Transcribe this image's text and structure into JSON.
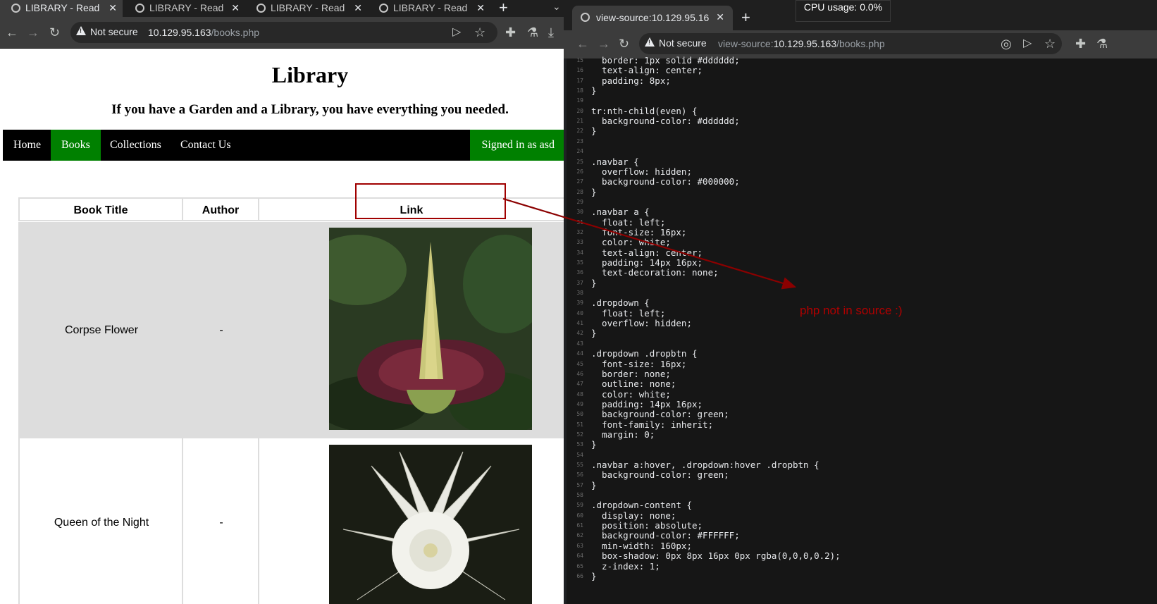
{
  "left_browser": {
    "tabs": [
      {
        "title": "LIBRARY - Read |"
      },
      {
        "title": "LIBRARY - Read |"
      },
      {
        "title": "LIBRARY - Read |"
      },
      {
        "title": "LIBRARY - Read |"
      }
    ],
    "security_label": "Not secure",
    "url_host": "10.129.95.163",
    "url_path": "/books.php"
  },
  "site": {
    "title": "Library",
    "subtitle": "If you have a Garden and a Library, you have everything you needed.",
    "nav": [
      {
        "label": "Home"
      },
      {
        "label": "Books"
      },
      {
        "label": "Collections"
      },
      {
        "label": "Contact Us"
      }
    ],
    "signed_in": "Signed in as asd",
    "table": {
      "headers": [
        "Book Title",
        "Author",
        "Link"
      ],
      "rows": [
        {
          "title": "Corpse Flower",
          "author": "-"
        },
        {
          "title": "Queen of the Night",
          "author": "-"
        }
      ]
    }
  },
  "right_browser": {
    "tab_title": "view-source:10.129.95.16",
    "cpu": "CPU usage: 0.0%",
    "url_prefix": "view-source:",
    "url_host": "10.129.95.163",
    "url_path": "/books.php",
    "source_lines": [
      {
        "n": "15",
        "t": "  border: 1px solid #dddddd;"
      },
      {
        "n": "16",
        "t": "  text-align: center;"
      },
      {
        "n": "17",
        "t": "  padding: 8px;"
      },
      {
        "n": "18",
        "t": "}"
      },
      {
        "n": "19",
        "t": ""
      },
      {
        "n": "20",
        "t": "tr:nth-child(even) {"
      },
      {
        "n": "21",
        "t": "  background-color: #dddddd;"
      },
      {
        "n": "22",
        "t": "}"
      },
      {
        "n": "23",
        "t": ""
      },
      {
        "n": "24",
        "t": ""
      },
      {
        "n": "25",
        "t": ".navbar {"
      },
      {
        "n": "26",
        "t": "  overflow: hidden;"
      },
      {
        "n": "27",
        "t": "  background-color: #000000;"
      },
      {
        "n": "28",
        "t": "}"
      },
      {
        "n": "29",
        "t": ""
      },
      {
        "n": "30",
        "t": ".navbar a {"
      },
      {
        "n": "31",
        "t": "  float: left;"
      },
      {
        "n": "32",
        "t": "  font-size: 16px;"
      },
      {
        "n": "33",
        "t": "  color: white;"
      },
      {
        "n": "34",
        "t": "  text-align: center;"
      },
      {
        "n": "35",
        "t": "  padding: 14px 16px;"
      },
      {
        "n": "36",
        "t": "  text-decoration: none;"
      },
      {
        "n": "37",
        "t": "}"
      },
      {
        "n": "38",
        "t": ""
      },
      {
        "n": "39",
        "t": ".dropdown {"
      },
      {
        "n": "40",
        "t": "  float: left;"
      },
      {
        "n": "41",
        "t": "  overflow: hidden;"
      },
      {
        "n": "42",
        "t": "}"
      },
      {
        "n": "43",
        "t": ""
      },
      {
        "n": "44",
        "t": ".dropdown .dropbtn {"
      },
      {
        "n": "45",
        "t": "  font-size: 16px;"
      },
      {
        "n": "46",
        "t": "  border: none;"
      },
      {
        "n": "47",
        "t": "  outline: none;"
      },
      {
        "n": "48",
        "t": "  color: white;"
      },
      {
        "n": "49",
        "t": "  padding: 14px 16px;"
      },
      {
        "n": "50",
        "t": "  background-color: green;"
      },
      {
        "n": "51",
        "t": "  font-family: inherit;"
      },
      {
        "n": "52",
        "t": "  margin: 0;"
      },
      {
        "n": "53",
        "t": "}"
      },
      {
        "n": "54",
        "t": ""
      },
      {
        "n": "55",
        "t": ".navbar a:hover, .dropdown:hover .dropbtn {"
      },
      {
        "n": "56",
        "t": "  background-color: green;"
      },
      {
        "n": "57",
        "t": "}"
      },
      {
        "n": "58",
        "t": ""
      },
      {
        "n": "59",
        "t": ".dropdown-content {"
      },
      {
        "n": "60",
        "t": "  display: none;"
      },
      {
        "n": "61",
        "t": "  position: absolute;"
      },
      {
        "n": "62",
        "t": "  background-color: #FFFFFF;"
      },
      {
        "n": "63",
        "t": "  min-width: 160px;"
      },
      {
        "n": "64",
        "t": "  box-shadow: 0px 8px 16px 0px rgba(0,0,0,0.2);"
      },
      {
        "n": "65",
        "t": "  z-index: 1;"
      },
      {
        "n": "66",
        "t": "}"
      }
    ]
  },
  "annotation": {
    "text": "php not in source :)",
    "color": "#b00000"
  },
  "colors": {
    "nav_active": "#008000",
    "navbar_bg": "#000000",
    "row_even": "#dddddd",
    "highlight_box": "#a00000"
  }
}
